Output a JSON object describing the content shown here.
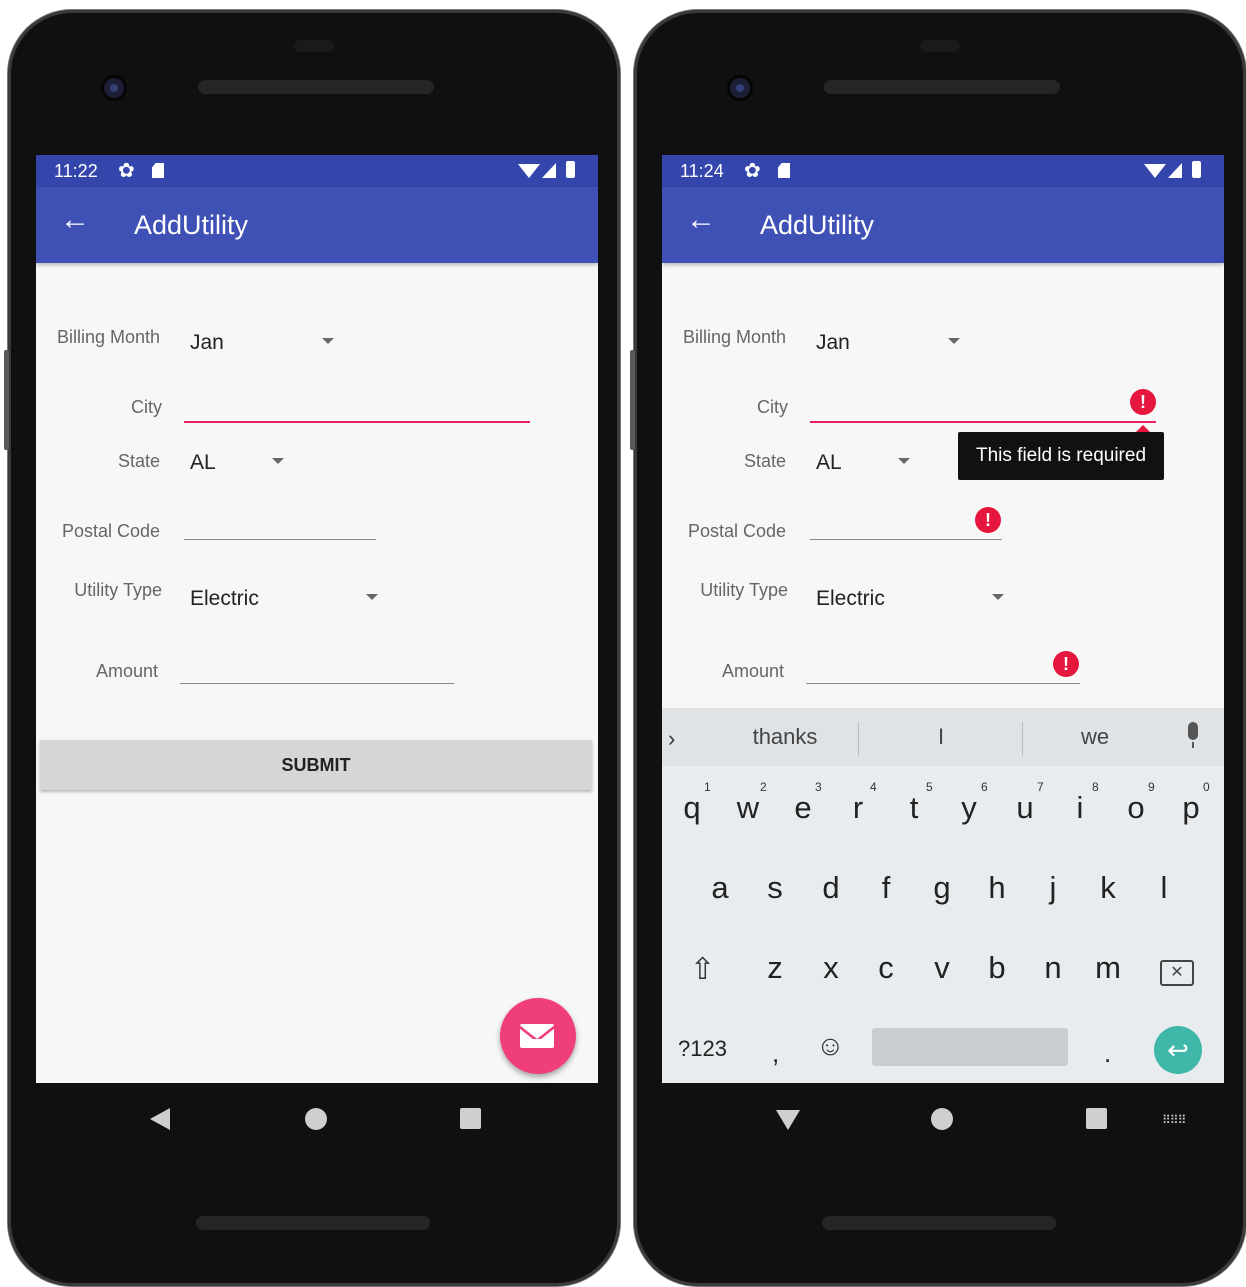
{
  "left": {
    "status": {
      "time": "11:22"
    },
    "appbar": {
      "title": "AddUtility",
      "back_icon": "arrow-left"
    },
    "form": {
      "billing_month_label": "Billing Month",
      "billing_month_value": "Jan",
      "city_label": "City",
      "city_value": "",
      "state_label": "State",
      "state_value": "AL",
      "postal_label": "Postal Code",
      "postal_value": "",
      "utility_label": "Utility Type",
      "utility_value": "Electric",
      "amount_label": "Amount",
      "amount_value": ""
    },
    "submit_label": "SUBMIT",
    "fab_icon": "mail-icon"
  },
  "right": {
    "status": {
      "time": "11:24"
    },
    "appbar": {
      "title": "AddUtility"
    },
    "form": {
      "billing_month_label": "Billing Month",
      "billing_month_value": "Jan",
      "city_label": "City",
      "state_label": "State",
      "state_value": "AL",
      "postal_label": "Postal Code",
      "utility_label": "Utility Type",
      "utility_value": "Electric",
      "amount_label": "Amount"
    },
    "error_tooltip": "This field is required",
    "error_mark": "!",
    "keyboard": {
      "suggestions": [
        "thanks",
        "I",
        "we"
      ],
      "row1": [
        "q",
        "w",
        "e",
        "r",
        "t",
        "y",
        "u",
        "i",
        "o",
        "p"
      ],
      "row1_nums": [
        "1",
        "2",
        "3",
        "4",
        "5",
        "6",
        "7",
        "8",
        "9",
        "0"
      ],
      "row2": [
        "a",
        "s",
        "d",
        "f",
        "g",
        "h",
        "j",
        "k",
        "l"
      ],
      "row3": [
        "z",
        "x",
        "c",
        "v",
        "b",
        "n",
        "m"
      ],
      "sym_label": "?123",
      "comma": ",",
      "period": ".",
      "enter_icon": "return-icon"
    }
  },
  "colors": {
    "statusbar": "#3446ab",
    "appbar": "#3f51b5",
    "accent": "#e91e63",
    "error": "#e5173f",
    "fab": "#f03e7a",
    "enter_key": "#3fb7a9"
  }
}
